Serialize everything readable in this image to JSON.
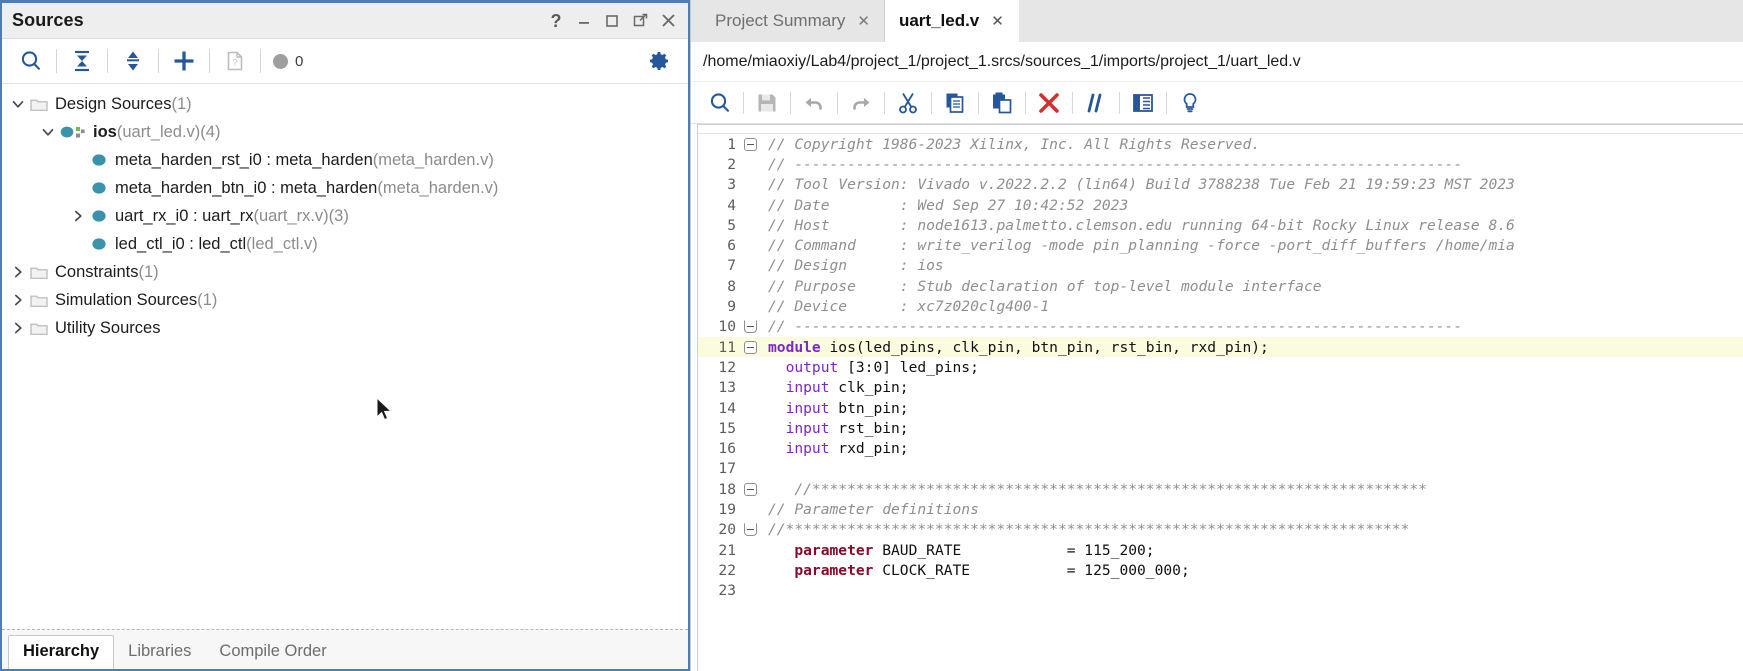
{
  "sources_panel": {
    "title": "Sources",
    "titlebar_buttons": [
      {
        "name": "help",
        "glyph": "?"
      },
      {
        "name": "minimize",
        "glyph": "—"
      },
      {
        "name": "maximize",
        "glyph": "□"
      },
      {
        "name": "float",
        "glyph": "⧉"
      },
      {
        "name": "close",
        "glyph": "✕"
      }
    ],
    "toolbar": {
      "search_label": "search-icon",
      "collapse_all_label": "collapse-all-icon",
      "expand_collapse_label": "expand-collapse-icon",
      "add_sources_label": "add-sources-icon",
      "report_label": "report-icon",
      "message_count": "0",
      "settings_label": "gear-icon"
    },
    "tree": [
      {
        "label": "Design Sources",
        "suffix": "(1)",
        "indent": 1,
        "icon": "folder-icon",
        "twisty": "expanded",
        "bold": false
      },
      {
        "label": "ios",
        "file": "(uart_led.v)",
        "suffix": "(4)",
        "indent": 2,
        "icon": "module-top-icon",
        "twisty": "expanded",
        "bold": true
      },
      {
        "label": "meta_harden_rst_i0 : meta_harden",
        "file": "(meta_harden.v)",
        "suffix": "",
        "indent": 3,
        "icon": "module-icon",
        "twisty": "none",
        "bold": false
      },
      {
        "label": "meta_harden_btn_i0 : meta_harden",
        "file": "(meta_harden.v)",
        "suffix": "",
        "indent": 3,
        "icon": "module-icon",
        "twisty": "none",
        "bold": false
      },
      {
        "label": "uart_rx_i0 : uart_rx",
        "file": "(uart_rx.v)",
        "suffix": "(3)",
        "indent": 3,
        "icon": "module-icon",
        "twisty": "collapsed",
        "bold": false
      },
      {
        "label": "led_ctl_i0 : led_ctl",
        "file": "(led_ctl.v)",
        "suffix": "",
        "indent": 3,
        "icon": "module-icon",
        "twisty": "none",
        "bold": false
      },
      {
        "label": "Constraints",
        "file": "",
        "suffix": "(1)",
        "indent": 1,
        "icon": "folder-icon",
        "twisty": "collapsed",
        "bold": false
      },
      {
        "label": "Simulation Sources",
        "file": "",
        "suffix": "(1)",
        "indent": 1,
        "icon": "folder-icon",
        "twisty": "collapsed",
        "bold": false
      },
      {
        "label": "Utility Sources",
        "file": "",
        "suffix": "",
        "indent": 1,
        "icon": "folder-icon",
        "twisty": "collapsed",
        "bold": false
      }
    ],
    "bottom_tabs": [
      {
        "label": "Hierarchy",
        "active": true
      },
      {
        "label": "Libraries",
        "active": false
      },
      {
        "label": "Compile Order",
        "active": false
      }
    ]
  },
  "editor_panel": {
    "tabs": [
      {
        "label": "Project Summary",
        "active": false,
        "close": "✕"
      },
      {
        "label": "uart_led.v",
        "active": true,
        "close": "✕"
      }
    ],
    "file_path": "/home/miaoxiy/Lab4/project_1/project_1.srcs/sources_1/imports/project_1/uart_led.v",
    "toolbar": [
      {
        "name": "find-icon"
      },
      {
        "name": "save-icon"
      },
      {
        "name": "undo-icon"
      },
      {
        "name": "redo-icon"
      },
      {
        "name": "cut-icon"
      },
      {
        "name": "copy-icon"
      },
      {
        "name": "paste-icon"
      },
      {
        "name": "delete-icon"
      },
      {
        "name": "comment-icon"
      },
      {
        "name": "table-icon"
      },
      {
        "name": "bulb-icon"
      }
    ],
    "code": [
      {
        "n": "1",
        "fold": "open-start",
        "hl": false,
        "tokens": [
          {
            "t": "// Copyright 1986-2023 Xilinx, Inc. All Rights Reserved.",
            "c": "c-com"
          }
        ]
      },
      {
        "n": "2",
        "fold": "line",
        "hl": false,
        "tokens": [
          {
            "t": "// ----------------------------------------------------------------------------",
            "c": "c-com"
          }
        ]
      },
      {
        "n": "3",
        "fold": "line",
        "hl": false,
        "tokens": [
          {
            "t": "// Tool Version: Vivado v.2022.2.2 (lin64) Build 3788238 Tue Feb 21 19:59:23 MST 2023",
            "c": "c-com"
          }
        ]
      },
      {
        "n": "4",
        "fold": "line",
        "hl": false,
        "tokens": [
          {
            "t": "// Date        : Wed Sep 27 10:42:52 2023",
            "c": "c-com"
          }
        ]
      },
      {
        "n": "5",
        "fold": "line",
        "hl": false,
        "tokens": [
          {
            "t": "// Host        : node1613.palmetto.clemson.edu running 64-bit Rocky Linux release 8.6",
            "c": "c-com"
          }
        ]
      },
      {
        "n": "6",
        "fold": "line",
        "hl": false,
        "tokens": [
          {
            "t": "// Command     : write_verilog -mode pin_planning -force -port_diff_buffers /home/mia",
            "c": "c-com"
          }
        ]
      },
      {
        "n": "7",
        "fold": "line",
        "hl": false,
        "tokens": [
          {
            "t": "// Design      : ios",
            "c": "c-com"
          }
        ]
      },
      {
        "n": "8",
        "fold": "line",
        "hl": false,
        "tokens": [
          {
            "t": "// Purpose     : Stub declaration of top-level module interface",
            "c": "c-com"
          }
        ]
      },
      {
        "n": "9",
        "fold": "line",
        "hl": false,
        "tokens": [
          {
            "t": "// Device      : xc7z020clg400-1",
            "c": "c-com"
          }
        ]
      },
      {
        "n": "10",
        "fold": "open-end",
        "hl": false,
        "tokens": [
          {
            "t": "// ----------------------------------------------------------------------------",
            "c": "c-com"
          }
        ]
      },
      {
        "n": "11",
        "fold": "open-start",
        "hl": true,
        "tokens": [
          {
            "t": "module",
            "c": "c-kw"
          },
          {
            "t": " ios(led_pins, clk_pin, btn_pin, rst_bin, rxd_pin);",
            "c": "c-txt"
          }
        ]
      },
      {
        "n": "12",
        "fold": "line",
        "hl": false,
        "tokens": [
          {
            "t": "  ",
            "c": "c-txt"
          },
          {
            "t": "output",
            "c": "c-kw2"
          },
          {
            "t": " [3:0] led_pins;",
            "c": "c-txt"
          }
        ]
      },
      {
        "n": "13",
        "fold": "line",
        "hl": false,
        "tokens": [
          {
            "t": "  ",
            "c": "c-txt"
          },
          {
            "t": "input",
            "c": "c-kw2"
          },
          {
            "t": " clk_pin;",
            "c": "c-txt"
          }
        ]
      },
      {
        "n": "14",
        "fold": "line",
        "hl": false,
        "tokens": [
          {
            "t": "  ",
            "c": "c-txt"
          },
          {
            "t": "input",
            "c": "c-kw2"
          },
          {
            "t": " btn_pin;",
            "c": "c-txt"
          }
        ]
      },
      {
        "n": "15",
        "fold": "line",
        "hl": false,
        "tokens": [
          {
            "t": "  ",
            "c": "c-txt"
          },
          {
            "t": "input",
            "c": "c-kw2"
          },
          {
            "t": " rst_bin;",
            "c": "c-txt"
          }
        ]
      },
      {
        "n": "16",
        "fold": "line",
        "hl": false,
        "tokens": [
          {
            "t": "  ",
            "c": "c-txt"
          },
          {
            "t": "input",
            "c": "c-kw2"
          },
          {
            "t": " rxd_pin;",
            "c": "c-txt"
          }
        ]
      },
      {
        "n": "17",
        "fold": "line",
        "hl": false,
        "tokens": [
          {
            "t": "",
            "c": "c-txt"
          }
        ]
      },
      {
        "n": "18",
        "fold": "open-start",
        "hl": false,
        "tokens": [
          {
            "t": "   //**********************************************************************",
            "c": "c-com"
          }
        ]
      },
      {
        "n": "19",
        "fold": "line",
        "hl": false,
        "tokens": [
          {
            "t": "// Parameter definitions",
            "c": "c-com"
          }
        ]
      },
      {
        "n": "20",
        "fold": "open-end",
        "hl": false,
        "tokens": [
          {
            "t": "//***********************************************************************",
            "c": "c-com"
          }
        ]
      },
      {
        "n": "21",
        "fold": "line",
        "hl": false,
        "tokens": [
          {
            "t": "   ",
            "c": "c-txt"
          },
          {
            "t": "parameter",
            "c": "c-par"
          },
          {
            "t": " BAUD_RATE            = 115_200;",
            "c": "c-txt"
          }
        ]
      },
      {
        "n": "22",
        "fold": "line",
        "hl": false,
        "tokens": [
          {
            "t": "   ",
            "c": "c-txt"
          },
          {
            "t": "parameter",
            "c": "c-par"
          },
          {
            "t": " CLOCK_RATE           = 125_000_000;",
            "c": "c-txt"
          }
        ]
      },
      {
        "n": "23",
        "fold": "line",
        "hl": false,
        "tokens": [
          {
            "t": "",
            "c": "c-txt"
          }
        ]
      }
    ]
  },
  "colors": {
    "panel_border": "#4a7ebb",
    "accent_blue": "#26579b",
    "module_teal": "#2f8fa8",
    "highlight_line": "#fbfbdd",
    "keyword_purple": "#7d26cd",
    "parameter_red": "#8b0a2a",
    "comment_gray": "#8f8f8f",
    "delete_red": "#d32f2f"
  }
}
